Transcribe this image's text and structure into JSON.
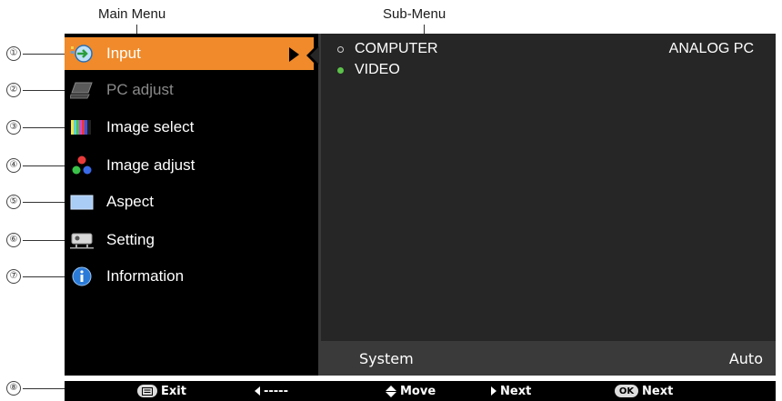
{
  "labels": {
    "main_menu": "Main Menu",
    "sub_menu": "Sub-Menu"
  },
  "callouts": [
    "①",
    "②",
    "③",
    "④",
    "⑤",
    "⑥",
    "⑦",
    "⑧"
  ],
  "main_menu": {
    "items": [
      {
        "label": "Input",
        "icon": "input-icon",
        "selected": true,
        "disabled": false
      },
      {
        "label": "PC adjust",
        "icon": "pc-adjust-icon",
        "selected": false,
        "disabled": true
      },
      {
        "label": "Image select",
        "icon": "image-select-icon",
        "selected": false,
        "disabled": false
      },
      {
        "label": "Image adjust",
        "icon": "image-adjust-icon",
        "selected": false,
        "disabled": false
      },
      {
        "label": "Aspect",
        "icon": "aspect-icon",
        "selected": false,
        "disabled": false
      },
      {
        "label": "Setting",
        "icon": "setting-icon",
        "selected": false,
        "disabled": false
      },
      {
        "label": "Information",
        "icon": "information-icon",
        "selected": false,
        "disabled": false
      }
    ]
  },
  "sub_menu": {
    "items": [
      {
        "label": "COMPUTER",
        "value": "ANALOG PC",
        "active": false
      },
      {
        "label": "VIDEO",
        "value": "",
        "active": true
      }
    ],
    "system_label": "System",
    "system_value": "Auto"
  },
  "hint_bar": {
    "exit": "Exit",
    "back": "-----",
    "move": "Move",
    "next1": "Next",
    "ok_key": "OK",
    "next2": "Next"
  },
  "colors": {
    "selected_bg": "#f08a2a",
    "active_dot": "#5cc24a"
  }
}
